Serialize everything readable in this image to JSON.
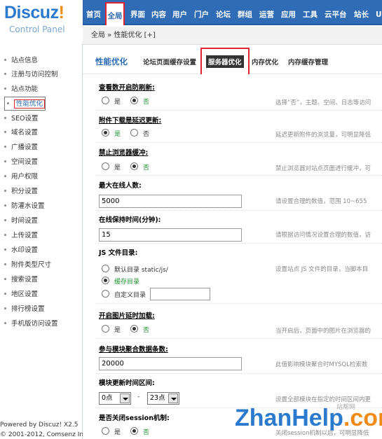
{
  "logo": {
    "brand": "Discuz",
    "mark": "!",
    "sub": "Control Panel"
  },
  "topnav": {
    "items": [
      "首页",
      "全局",
      "界面",
      "内容",
      "用户",
      "门户",
      "论坛",
      "群组",
      "运营",
      "应用",
      "工具",
      "云平台",
      "站长",
      "UC"
    ],
    "active": "全局"
  },
  "breadcrumb": "全局 » 性能优化 [+]",
  "sidebar": {
    "items": [
      "站点信息",
      "注册与访问控制",
      "站点功能",
      "性能优化",
      "SEO设置",
      "域名设置",
      "广播设置",
      "空间设置",
      "用户权限",
      "积分设置",
      "防灌水设置",
      "时间设置",
      "上传设置",
      "水印设置",
      "附件类型尺寸",
      "搜索设置",
      "地区设置",
      "排行榜设置",
      "手机版访问设置"
    ],
    "selected": "性能优化",
    "footer1": "Powered by Discuz! X2.5",
    "footer2": "© 2001-2012, Comsenz Inc."
  },
  "tabs": {
    "title": "性能优化",
    "items": [
      "论坛页面缓存设置",
      "服务器优化",
      "内存优化",
      "内存缓存管理"
    ],
    "active": "服务器优化"
  },
  "settings": [
    {
      "label": "查看数开启防刷新:",
      "hint": "选择“否”，主题、空间、日志等访问",
      "options": [
        "是",
        "否"
      ],
      "selected": 1
    },
    {
      "label": "附件下载是延迟更新:",
      "hint": "延迟更新附件的浏览量，可明显降低",
      "options": [
        "是",
        "否"
      ],
      "selected": 0
    },
    {
      "label": "禁止浏览器缓冲:",
      "hint": "禁止浏览器对站点页面进行缓冲，可",
      "options": [
        "是",
        "否"
      ],
      "selected": 1
    },
    {
      "label": "最大在线人数:",
      "hint": "请设置合理的数值，范围 10~655",
      "value": "5000"
    },
    {
      "label": "在线保持时间(分钟):",
      "hint": "请根据访问情况设置合理的数值，访",
      "value": "15"
    },
    {
      "label": "JS 文件目录:",
      "hint": "设置站点 JS 文件的目录，当脚本目",
      "options": [
        "默认目录 static/js/",
        "缓存目录",
        "自定义目录"
      ],
      "selected": 1
    },
    {
      "label": "开启图片延时加载:",
      "hint": "当开启后，页面中的图片在浏览器的",
      "options": [
        "是",
        "否"
      ],
      "selected": 1
    },
    {
      "label": "参与模块聚合数据条数:",
      "hint": "此值影响模块聚合时MYSQL检索数",
      "value": "20000"
    },
    {
      "label": "模块更新时间区间:",
      "hint": "设置全部模块在指定的时间区间内更",
      "from": "0点",
      "to": "23点",
      "dash": "-"
    },
    {
      "label": "是否关闭session机制:",
      "hint": "关闭session机制以后，可明显降低",
      "options": [
        "是",
        "否"
      ],
      "selected": 1
    }
  ],
  "watermark": {
    "text": "ZhanHelp",
    "tld": ".com",
    "cn": "站帮网"
  }
}
